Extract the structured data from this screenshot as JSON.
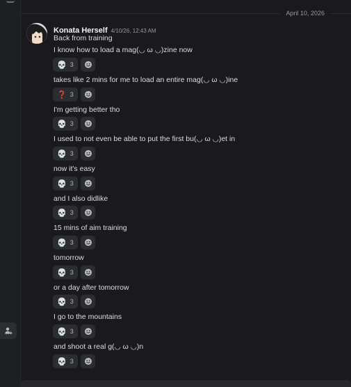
{
  "divider": {
    "date": "April 10, 2026"
  },
  "message": {
    "author": "Konata Herself",
    "timestamp": "4/10/26, 12:43 AM",
    "avatar_icon": "anime-avatar",
    "lines": [
      {
        "text": "Back from training",
        "reactions": []
      },
      {
        "text": "I know how to load a mag(◡ ω ◡)zine now",
        "reactions": [
          {
            "emoji": "💀",
            "icon": "skull-emoji",
            "count": "3"
          }
        ]
      },
      {
        "text": "takes like 2 mins for me to load an entire mag(◡ ω ◡)ine",
        "reactions": [
          {
            "emoji": "❓",
            "icon": "question-emoji",
            "count": "3"
          }
        ]
      },
      {
        "text": "I'm getting better tho",
        "reactions": [
          {
            "emoji": "💀",
            "icon": "skull-emoji",
            "count": "3"
          }
        ]
      },
      {
        "text": "I used to not even be able to put the first bu(◡ ω ◡)et in",
        "reactions": [
          {
            "emoji": "💀",
            "icon": "skull-emoji",
            "count": "3"
          }
        ]
      },
      {
        "text": "now it's easy",
        "reactions": [
          {
            "emoji": "💀",
            "icon": "skull-emoji",
            "count": "3"
          }
        ]
      },
      {
        "text": "and I also didlike",
        "reactions": [
          {
            "emoji": "💀",
            "icon": "skull-emoji",
            "count": "3"
          }
        ]
      },
      {
        "text": "15 mins of aim training",
        "reactions": [
          {
            "emoji": "💀",
            "icon": "skull-emoji",
            "count": "3"
          }
        ]
      },
      {
        "text": "tomorrow",
        "reactions": [
          {
            "emoji": "💀",
            "icon": "skull-emoji",
            "count": "3"
          }
        ]
      },
      {
        "text": "or a day after tomorrow",
        "reactions": [
          {
            "emoji": "💀",
            "icon": "skull-emoji",
            "count": "3"
          }
        ]
      },
      {
        "text": "I go to the mountains",
        "reactions": [
          {
            "emoji": "💀",
            "icon": "skull-emoji",
            "count": "3"
          }
        ]
      },
      {
        "text": "and shoot a real g(◡ ω ◡)n",
        "reactions": [
          {
            "emoji": "💀",
            "icon": "skull-emoji",
            "count": "3"
          }
        ]
      }
    ]
  },
  "colors": {
    "background": "#1a1a1e",
    "reaction_pill": "#2b2d31",
    "author": "#f2f3f5",
    "text": "#dbdee1",
    "muted": "#949ba4"
  }
}
